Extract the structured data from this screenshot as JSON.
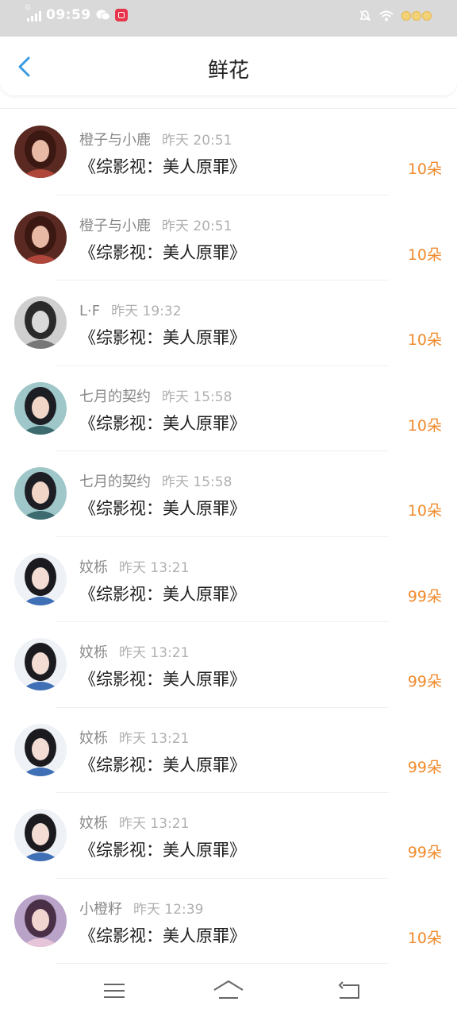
{
  "status": {
    "time": "09:59",
    "network": "G"
  },
  "header": {
    "title": "鲜花"
  },
  "rows": [
    {
      "name": "橙子与小鹿",
      "time": "昨天 20:51",
      "book": "《综影视：美人原罪》",
      "amount": "10朵",
      "avatar": "girl-red"
    },
    {
      "name": "橙子与小鹿",
      "time": "昨天 20:51",
      "book": "《综影视：美人原罪》",
      "amount": "10朵",
      "avatar": "girl-red"
    },
    {
      "name": "L·F",
      "time": "昨天 19:32",
      "book": "《综影视：美人原罪》",
      "amount": "10朵",
      "avatar": "boy-gray"
    },
    {
      "name": "七月的契约",
      "time": "昨天 15:58",
      "book": "《综影视：美人原罪》",
      "amount": "10朵",
      "avatar": "costume-teal"
    },
    {
      "name": "七月的契约",
      "time": "昨天 15:58",
      "book": "《综影视：美人原罪》",
      "amount": "10朵",
      "avatar": "costume-teal"
    },
    {
      "name": "妏栎",
      "time": "昨天 13:21",
      "book": "《综影视：美人原罪》",
      "amount": "99朵",
      "avatar": "actress-blue"
    },
    {
      "name": "妏栎",
      "time": "昨天 13:21",
      "book": "《综影视：美人原罪》",
      "amount": "99朵",
      "avatar": "actress-blue"
    },
    {
      "name": "妏栎",
      "time": "昨天 13:21",
      "book": "《综影视：美人原罪》",
      "amount": "99朵",
      "avatar": "actress-blue"
    },
    {
      "name": "妏栎",
      "time": "昨天 13:21",
      "book": "《综影视：美人原罪》",
      "amount": "99朵",
      "avatar": "actress-blue"
    },
    {
      "name": "小橙籽",
      "time": "昨天 12:39",
      "book": "《综影视：美人原罪》",
      "amount": "10朵",
      "avatar": "girl-purple"
    }
  ],
  "colors": {
    "accent": "#3a9be0",
    "amount": "#f08a2c",
    "statusbar": "#d9d9d9"
  },
  "icons": {
    "back": "chevron-left-icon",
    "nav_menu": "menu-icon",
    "nav_home": "home-icon",
    "nav_back": "return-icon"
  }
}
